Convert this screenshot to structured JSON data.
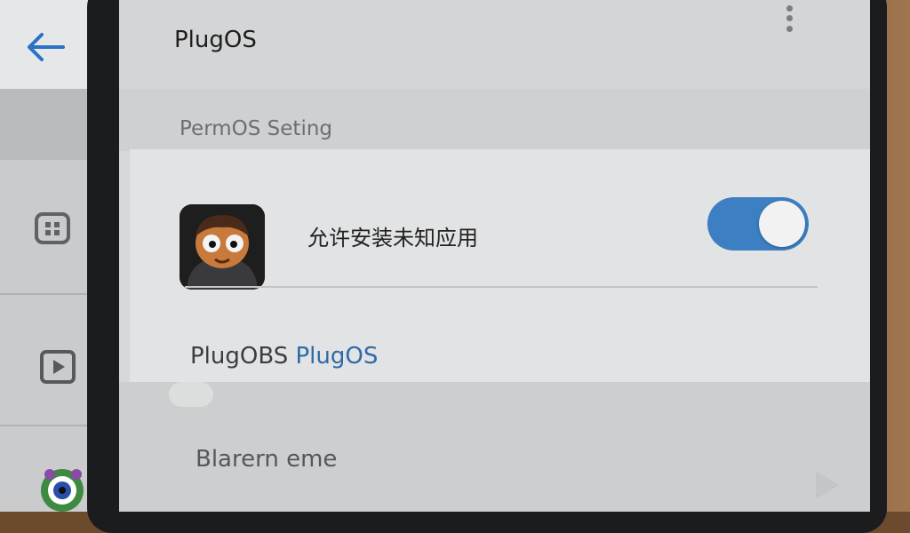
{
  "left_panel": {
    "back_icon": "arrow-left-icon",
    "items": [
      {
        "icon": "grid-widget-icon"
      },
      {
        "icon": "play-box-icon"
      },
      {
        "icon": "gear-eye-icon"
      }
    ]
  },
  "appbar": {
    "title": "PlugOS",
    "menu_icon": "more-vertical-icon"
  },
  "section": {
    "title": "PermOS Seting"
  },
  "install_row": {
    "icon": "app-avatar-icon",
    "label": "允许安装未知应用",
    "toggle_state": "on"
  },
  "source_row": {
    "prefix": "PlugOBS",
    "accent": "PlugOS"
  },
  "lower_row": {
    "label": "Blarern eme"
  },
  "colors": {
    "accent": "#3c7fc2",
    "link": "#2f6aa8",
    "back_arrow": "#2a72c4"
  }
}
